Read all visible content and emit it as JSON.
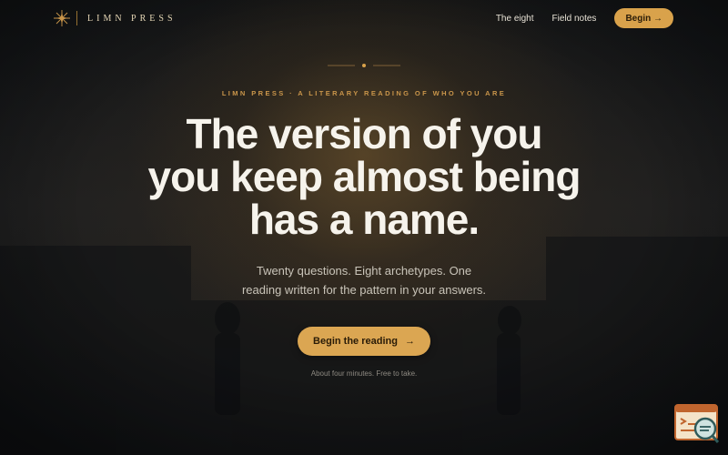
{
  "nav": {
    "brand_name": "LIMN PRESS",
    "brand_icon": "compass-star-icon",
    "links": [
      "The eight",
      "Field notes"
    ],
    "begin_label": "Begin →"
  },
  "hero": {
    "ornament_icon": "diamond-divider-icon",
    "eyebrow": "LIMN PRESS · A LITERARY READING OF WHO YOU ARE",
    "headline_lines": [
      "The version of you",
      "you keep almost being",
      "has a name."
    ],
    "subhead_lines": [
      "Twenty questions. Eight archetypes. One",
      "reading written for the pattern in your answers."
    ],
    "cta_label": "Begin the reading",
    "cta_arrow": "→",
    "note": "About four minutes. Free to take."
  },
  "widget": {
    "icon": "console-search-icon"
  },
  "colors": {
    "accent": "#d9a24b",
    "background": "#16181b",
    "text": "#f6f3ec"
  }
}
